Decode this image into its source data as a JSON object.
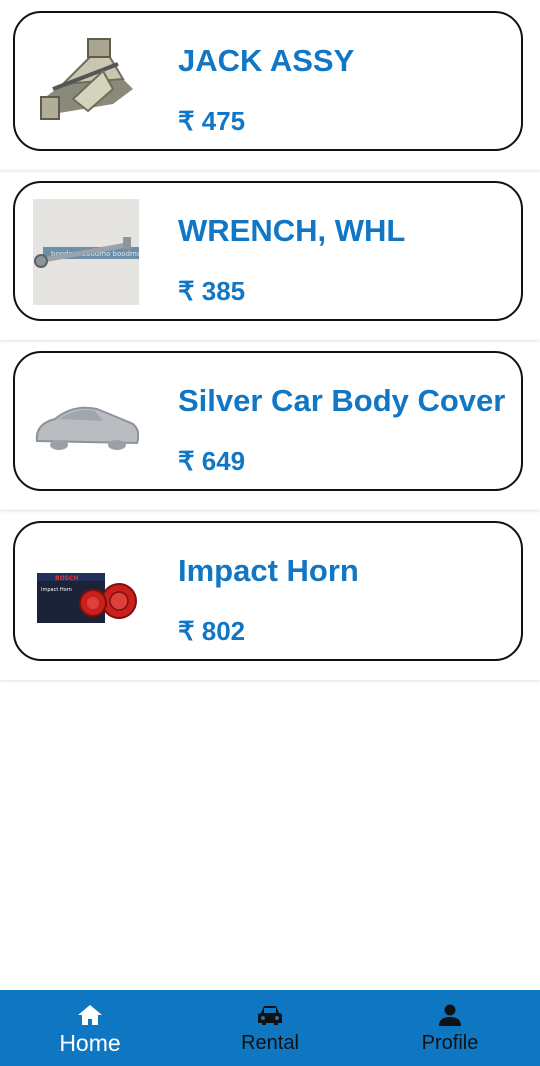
{
  "products": [
    {
      "name": "JACK ASSY",
      "price": "₹ 475",
      "image": "jack-image"
    },
    {
      "name": "WRENCH, WHL",
      "price": "₹ 385",
      "image": "wrench-image"
    },
    {
      "name": "Silver Car Body Cover",
      "price": "₹ 649",
      "image": "car-cover-image"
    },
    {
      "name": "Impact Horn",
      "price": "₹ 802",
      "image": "horn-image"
    }
  ],
  "wrench_box_text": "boodmo boodmo boodmo",
  "horn_box": {
    "brand": "BOSCH",
    "product": "Impact Horn"
  },
  "nav": {
    "home": {
      "label": "Home",
      "icon": "home-icon"
    },
    "rental": {
      "label": "Rental",
      "icon": "car-icon"
    },
    "profile": {
      "label": "Profile",
      "icon": "person-icon"
    }
  },
  "colors": {
    "accent": "#1177c4",
    "navbar": "#0f76c2"
  }
}
